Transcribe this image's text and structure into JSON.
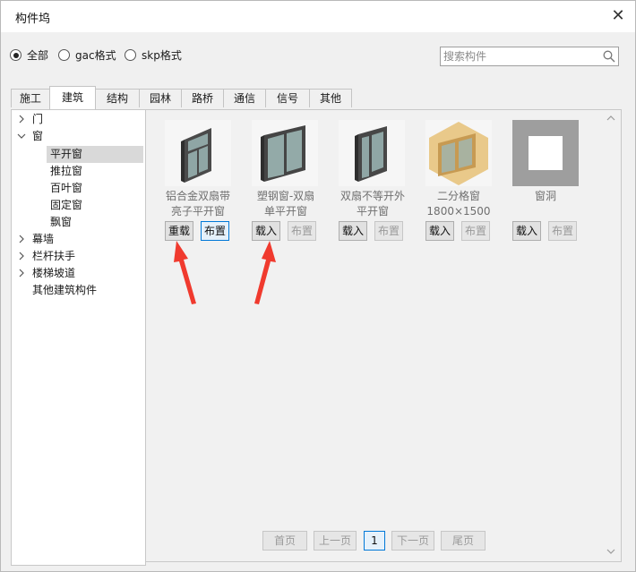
{
  "window": {
    "title": "构件坞",
    "close_glyph": "✕"
  },
  "filters": [
    {
      "label": "全部",
      "checked": true
    },
    {
      "label": "gac格式",
      "checked": false
    },
    {
      "label": "skp格式",
      "checked": false
    }
  ],
  "search": {
    "placeholder": "搜索构件",
    "value": "",
    "icon": "search-icon"
  },
  "tabs": [
    "施工",
    "建筑",
    "结构",
    "园林",
    "路桥",
    "通信",
    "信号",
    "其他"
  ],
  "active_tab": "建筑",
  "tree": [
    {
      "label": "门",
      "toggle": "collapsed"
    },
    {
      "label": "窗",
      "toggle": "expanded"
    },
    {
      "label": "平开窗",
      "child": true,
      "selected": true
    },
    {
      "label": "推拉窗",
      "child": true
    },
    {
      "label": "百叶窗",
      "child": true
    },
    {
      "label": "固定窗",
      "child": true
    },
    {
      "label": "飘窗",
      "child": true
    },
    {
      "label": "幕墙",
      "toggle": "collapsed"
    },
    {
      "label": "栏杆扶手",
      "toggle": "collapsed"
    },
    {
      "label": "楼梯坡道",
      "toggle": "collapsed"
    },
    {
      "label": "其他建筑构件"
    }
  ],
  "components": [
    {
      "name_line1": "铝合金双扇带",
      "name_line2": "亮子平开窗",
      "primary": "重载",
      "secondary": "布置",
      "secondary_enabled": true,
      "icon": "aluminum-double-window-icon"
    },
    {
      "name_line1": "塑钢窗-双扇",
      "name_line2": "单平开窗",
      "primary": "载入",
      "secondary": "布置",
      "secondary_enabled": false,
      "icon": "upvc-double-window-icon"
    },
    {
      "name_line1": "双扇不等开外",
      "name_line2": "平开窗",
      "primary": "载入",
      "secondary": "布置",
      "secondary_enabled": false,
      "icon": "unequal-double-window-icon"
    },
    {
      "name_line1": "二分格窗",
      "name_line2": "1800×1500",
      "primary": "载入",
      "secondary": "布置",
      "secondary_enabled": false,
      "icon": "two-pane-wood-window-icon"
    },
    {
      "name_line1": "窗洞",
      "name_line2": "",
      "primary": "载入",
      "secondary": "布置",
      "secondary_enabled": false,
      "icon": "window-opening-icon"
    }
  ],
  "pager": {
    "first": "首页",
    "prev": "上一页",
    "current": "1",
    "next": "下一页",
    "last": "尾页"
  },
  "colors": {
    "accent": "#0078d7",
    "annotation_arrow": "#f03a2e",
    "wood": "#e9c98a"
  }
}
